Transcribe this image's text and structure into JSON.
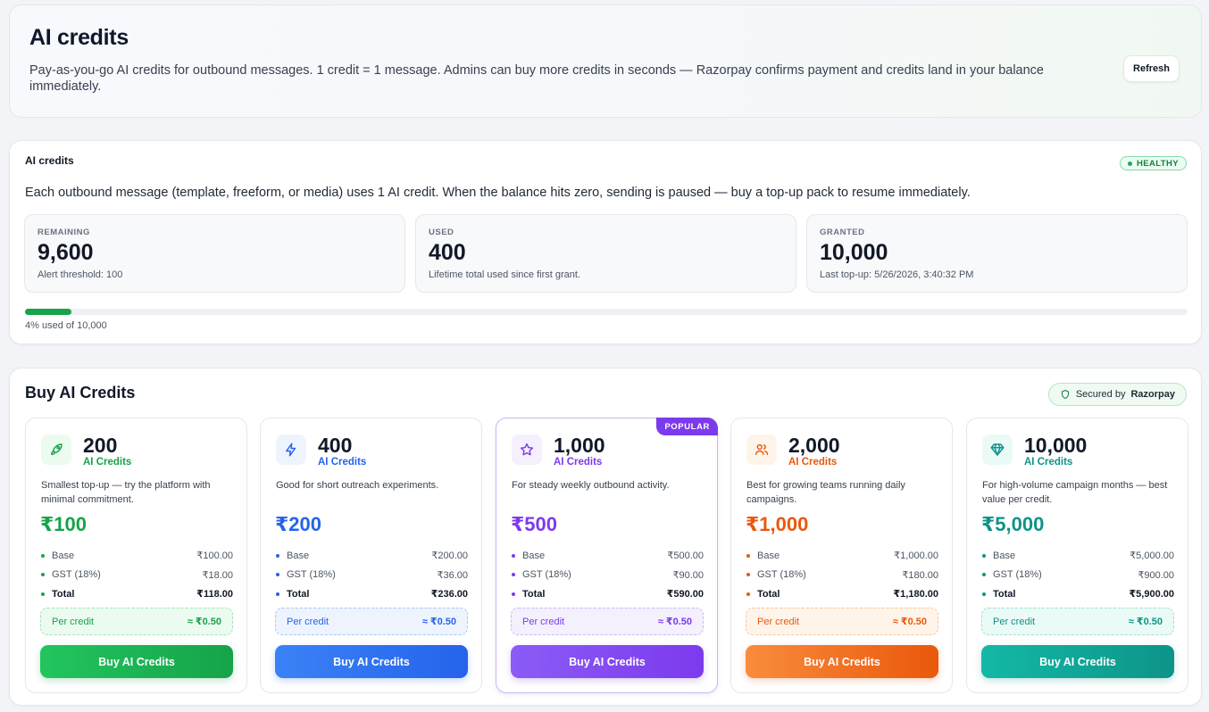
{
  "header": {
    "title": "AI credits",
    "subtitle": "Pay-as-you-go AI credits for outbound messages. 1 credit = 1 message. Admins can buy more credits in seconds — Razorpay confirms payment and credits land in your balance immediately.",
    "refresh_label": "Refresh"
  },
  "usage": {
    "title": "AI credits",
    "status": "HEALTHY",
    "description": "Each outbound message (template, freeform, or media) uses 1 AI credit. When the balance hits zero, sending is paused — buy a top-up pack to resume immediately.",
    "stats": [
      {
        "label": "REMAINING",
        "value": "9,600",
        "note": "Alert threshold: 100"
      },
      {
        "label": "USED",
        "value": "400",
        "note": "Lifetime total used since first grant."
      },
      {
        "label": "GRANTED",
        "value": "10,000",
        "note": "Last top-up: 5/26/2026, 3:40:32 PM"
      }
    ],
    "progress_fraction": 0.04,
    "progress_caption": "4% used of 10,000"
  },
  "buy": {
    "title": "Buy AI Credits",
    "secure_prefix": "Secured by",
    "secure_brand": "Razorpay",
    "packs": [
      {
        "credits": "200",
        "unit": "AI Credits",
        "icon": "rocket-icon",
        "description": "Smallest top-up — try the platform with minimal commitment.",
        "price": "₹100",
        "base_label": "Base",
        "base": "₹100.00",
        "gst_label": "GST (18%)",
        "gst": "₹18.00",
        "total_label": "Total",
        "total": "₹118.00",
        "per_credit_label": "Per credit",
        "per_credit": "≈ ₹0.50",
        "button_label": "Buy AI Credits",
        "accent": "#16a34a",
        "tint": "#ecfbf0",
        "border": "#a7e3b9",
        "btn_from": "#22c55e",
        "btn_to": "#16a34a",
        "popular": ""
      },
      {
        "credits": "400",
        "unit": "AI Credits",
        "icon": "lightning-icon",
        "description": "Good for short outreach experiments.",
        "price": "₹200",
        "base_label": "Base",
        "base": "₹200.00",
        "gst_label": "GST (18%)",
        "gst": "₹36.00",
        "total_label": "Total",
        "total": "₹236.00",
        "per_credit_label": "Per credit",
        "per_credit": "≈ ₹0.50",
        "button_label": "Buy AI Credits",
        "accent": "#2563eb",
        "tint": "#eef4fe",
        "border": "#aac6f5",
        "btn_from": "#3b82f6",
        "btn_to": "#2563eb",
        "popular": ""
      },
      {
        "credits": "1,000",
        "unit": "AI Credits",
        "icon": "star-icon",
        "description": "For steady weekly outbound activity.",
        "price": "₹500",
        "base_label": "Base",
        "base": "₹500.00",
        "gst_label": "GST (18%)",
        "gst": "₹90.00",
        "total_label": "Total",
        "total": "₹590.00",
        "per_credit_label": "Per credit",
        "per_credit": "≈ ₹0.50",
        "button_label": "Buy AI Credits",
        "accent": "#7c3aed",
        "tint": "#f4f0fd",
        "border": "#cdb9f3",
        "btn_from": "#8b5cf6",
        "btn_to": "#7c3aed",
        "popular": "POPULAR"
      },
      {
        "credits": "2,000",
        "unit": "AI Credits",
        "icon": "users-icon",
        "description": "Best for growing teams running daily campaigns.",
        "price": "₹1,000",
        "base_label": "Base",
        "base": "₹1,000.00",
        "gst_label": "GST (18%)",
        "gst": "₹180.00",
        "total_label": "Total",
        "total": "₹1,180.00",
        "per_credit_label": "Per credit",
        "per_credit": "≈ ₹0.50",
        "button_label": "Buy AI Credits",
        "accent": "#ea580c",
        "tint": "#fff4ea",
        "border": "#f6c79c",
        "btn_from": "#f98c3c",
        "btn_to": "#ea580c",
        "popular": ""
      },
      {
        "credits": "10,000",
        "unit": "AI Credits",
        "icon": "diamond-icon",
        "description": "For high-volume campaign months — best value per credit.",
        "price": "₹5,000",
        "base_label": "Base",
        "base": "₹5,000.00",
        "gst_label": "GST (18%)",
        "gst": "₹900.00",
        "total_label": "Total",
        "total": "₹5,900.00",
        "per_credit_label": "Per credit",
        "per_credit": "≈ ₹0.50",
        "button_label": "Buy AI Credits",
        "accent": "#0d9488",
        "tint": "#eafaf6",
        "border": "#9fe0d3",
        "btn_from": "#14b8a6",
        "btn_to": "#0d9488",
        "popular": ""
      }
    ]
  }
}
